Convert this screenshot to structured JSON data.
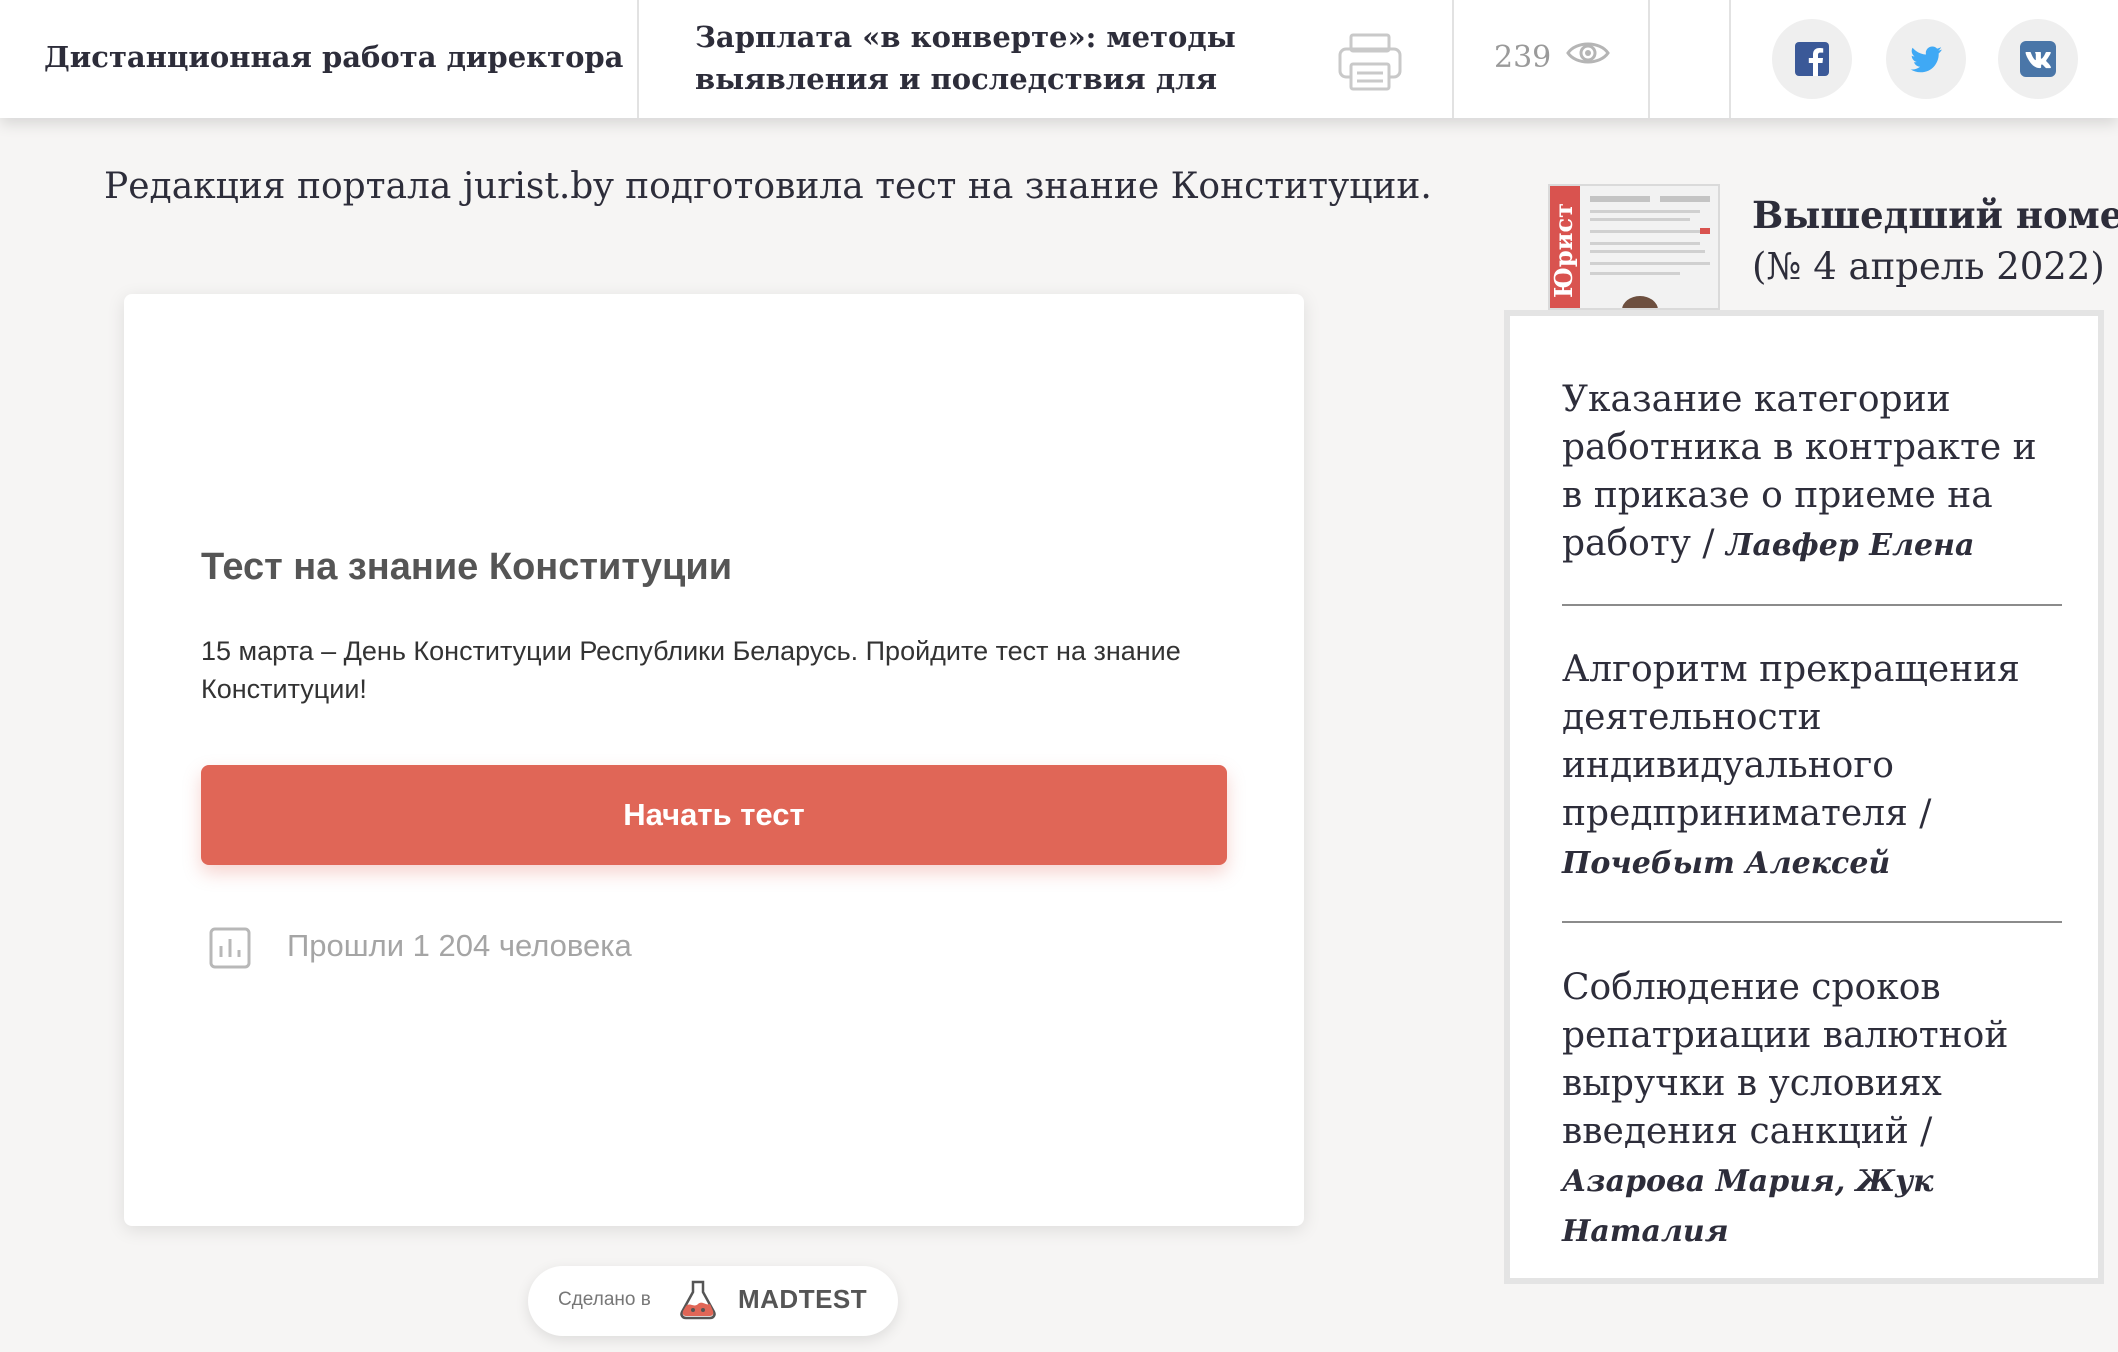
{
  "topbar": {
    "prev_article": "Дистанционная работа директора",
    "next_article": "Зарплата «в конверте»: методы выявления и последствия для",
    "views_count": "239",
    "icons": {
      "print": "printer-icon",
      "views": "eye-icon",
      "facebook": "facebook-icon",
      "twitter": "twitter-icon",
      "vk": "vk-icon"
    }
  },
  "intro": "Редакция портала jurist.by подготовила тест на знание Конституции.",
  "quiz": {
    "title": "Тест на знание Конституции",
    "description": "15 марта – День Конституции Республики Беларусь. Пройдите тест на знание Конституции!",
    "start_button": "Начать тест",
    "stats": "Прошли 1 204 человека",
    "accent_color": "#e06657"
  },
  "badge": {
    "made_in": "Сделано в",
    "brand": "MADTEST"
  },
  "sidebar": {
    "issue_title": "Вышедший номер",
    "issue_number": "(№ 4 апрель 2022)",
    "cover_logo": "Юрист",
    "articles": [
      {
        "title": "Указание категории работника в контракте и в приказе о приеме на работу",
        "sep": " / ",
        "author": "Лавфер Елена"
      },
      {
        "title": "Алгоритм прекращения деятельности индивидуального предпринимателя",
        "sep": " / ",
        "author": "Почебыт Алексей"
      },
      {
        "title": "Соблюдение сроков репатриации валютной выручки в условиях введения санкций",
        "sep": " / ",
        "author": "Азарова Мария,  Жук Наталия"
      }
    ]
  }
}
